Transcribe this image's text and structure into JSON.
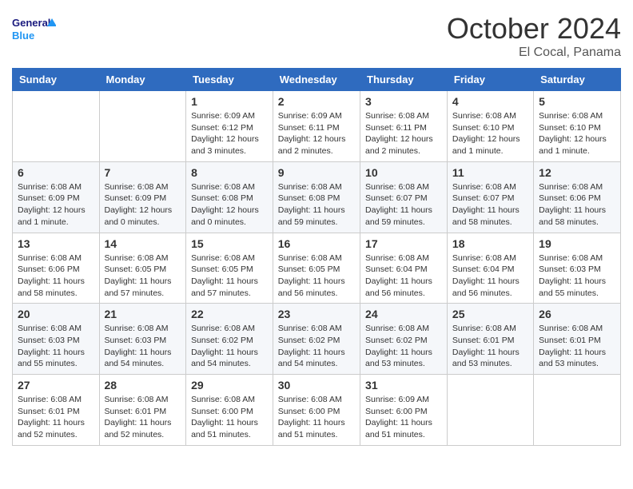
{
  "header": {
    "logo_text_general": "General",
    "logo_text_blue": "Blue",
    "month_title": "October 2024",
    "location": "El Cocal, Panama"
  },
  "weekdays": [
    "Sunday",
    "Monday",
    "Tuesday",
    "Wednesday",
    "Thursday",
    "Friday",
    "Saturday"
  ],
  "weeks": [
    [
      {
        "day": "",
        "info": ""
      },
      {
        "day": "",
        "info": ""
      },
      {
        "day": "1",
        "info": "Sunrise: 6:09 AM\nSunset: 6:12 PM\nDaylight: 12 hours and 3 minutes."
      },
      {
        "day": "2",
        "info": "Sunrise: 6:09 AM\nSunset: 6:11 PM\nDaylight: 12 hours and 2 minutes."
      },
      {
        "day": "3",
        "info": "Sunrise: 6:08 AM\nSunset: 6:11 PM\nDaylight: 12 hours and 2 minutes."
      },
      {
        "day": "4",
        "info": "Sunrise: 6:08 AM\nSunset: 6:10 PM\nDaylight: 12 hours and 1 minute."
      },
      {
        "day": "5",
        "info": "Sunrise: 6:08 AM\nSunset: 6:10 PM\nDaylight: 12 hours and 1 minute."
      }
    ],
    [
      {
        "day": "6",
        "info": "Sunrise: 6:08 AM\nSunset: 6:09 PM\nDaylight: 12 hours and 1 minute."
      },
      {
        "day": "7",
        "info": "Sunrise: 6:08 AM\nSunset: 6:09 PM\nDaylight: 12 hours and 0 minutes."
      },
      {
        "day": "8",
        "info": "Sunrise: 6:08 AM\nSunset: 6:08 PM\nDaylight: 12 hours and 0 minutes."
      },
      {
        "day": "9",
        "info": "Sunrise: 6:08 AM\nSunset: 6:08 PM\nDaylight: 11 hours and 59 minutes."
      },
      {
        "day": "10",
        "info": "Sunrise: 6:08 AM\nSunset: 6:07 PM\nDaylight: 11 hours and 59 minutes."
      },
      {
        "day": "11",
        "info": "Sunrise: 6:08 AM\nSunset: 6:07 PM\nDaylight: 11 hours and 58 minutes."
      },
      {
        "day": "12",
        "info": "Sunrise: 6:08 AM\nSunset: 6:06 PM\nDaylight: 11 hours and 58 minutes."
      }
    ],
    [
      {
        "day": "13",
        "info": "Sunrise: 6:08 AM\nSunset: 6:06 PM\nDaylight: 11 hours and 58 minutes."
      },
      {
        "day": "14",
        "info": "Sunrise: 6:08 AM\nSunset: 6:05 PM\nDaylight: 11 hours and 57 minutes."
      },
      {
        "day": "15",
        "info": "Sunrise: 6:08 AM\nSunset: 6:05 PM\nDaylight: 11 hours and 57 minutes."
      },
      {
        "day": "16",
        "info": "Sunrise: 6:08 AM\nSunset: 6:05 PM\nDaylight: 11 hours and 56 minutes."
      },
      {
        "day": "17",
        "info": "Sunrise: 6:08 AM\nSunset: 6:04 PM\nDaylight: 11 hours and 56 minutes."
      },
      {
        "day": "18",
        "info": "Sunrise: 6:08 AM\nSunset: 6:04 PM\nDaylight: 11 hours and 56 minutes."
      },
      {
        "day": "19",
        "info": "Sunrise: 6:08 AM\nSunset: 6:03 PM\nDaylight: 11 hours and 55 minutes."
      }
    ],
    [
      {
        "day": "20",
        "info": "Sunrise: 6:08 AM\nSunset: 6:03 PM\nDaylight: 11 hours and 55 minutes."
      },
      {
        "day": "21",
        "info": "Sunrise: 6:08 AM\nSunset: 6:03 PM\nDaylight: 11 hours and 54 minutes."
      },
      {
        "day": "22",
        "info": "Sunrise: 6:08 AM\nSunset: 6:02 PM\nDaylight: 11 hours and 54 minutes."
      },
      {
        "day": "23",
        "info": "Sunrise: 6:08 AM\nSunset: 6:02 PM\nDaylight: 11 hours and 54 minutes."
      },
      {
        "day": "24",
        "info": "Sunrise: 6:08 AM\nSunset: 6:02 PM\nDaylight: 11 hours and 53 minutes."
      },
      {
        "day": "25",
        "info": "Sunrise: 6:08 AM\nSunset: 6:01 PM\nDaylight: 11 hours and 53 minutes."
      },
      {
        "day": "26",
        "info": "Sunrise: 6:08 AM\nSunset: 6:01 PM\nDaylight: 11 hours and 53 minutes."
      }
    ],
    [
      {
        "day": "27",
        "info": "Sunrise: 6:08 AM\nSunset: 6:01 PM\nDaylight: 11 hours and 52 minutes."
      },
      {
        "day": "28",
        "info": "Sunrise: 6:08 AM\nSunset: 6:01 PM\nDaylight: 11 hours and 52 minutes."
      },
      {
        "day": "29",
        "info": "Sunrise: 6:08 AM\nSunset: 6:00 PM\nDaylight: 11 hours and 51 minutes."
      },
      {
        "day": "30",
        "info": "Sunrise: 6:08 AM\nSunset: 6:00 PM\nDaylight: 11 hours and 51 minutes."
      },
      {
        "day": "31",
        "info": "Sunrise: 6:09 AM\nSunset: 6:00 PM\nDaylight: 11 hours and 51 minutes."
      },
      {
        "day": "",
        "info": ""
      },
      {
        "day": "",
        "info": ""
      }
    ]
  ]
}
